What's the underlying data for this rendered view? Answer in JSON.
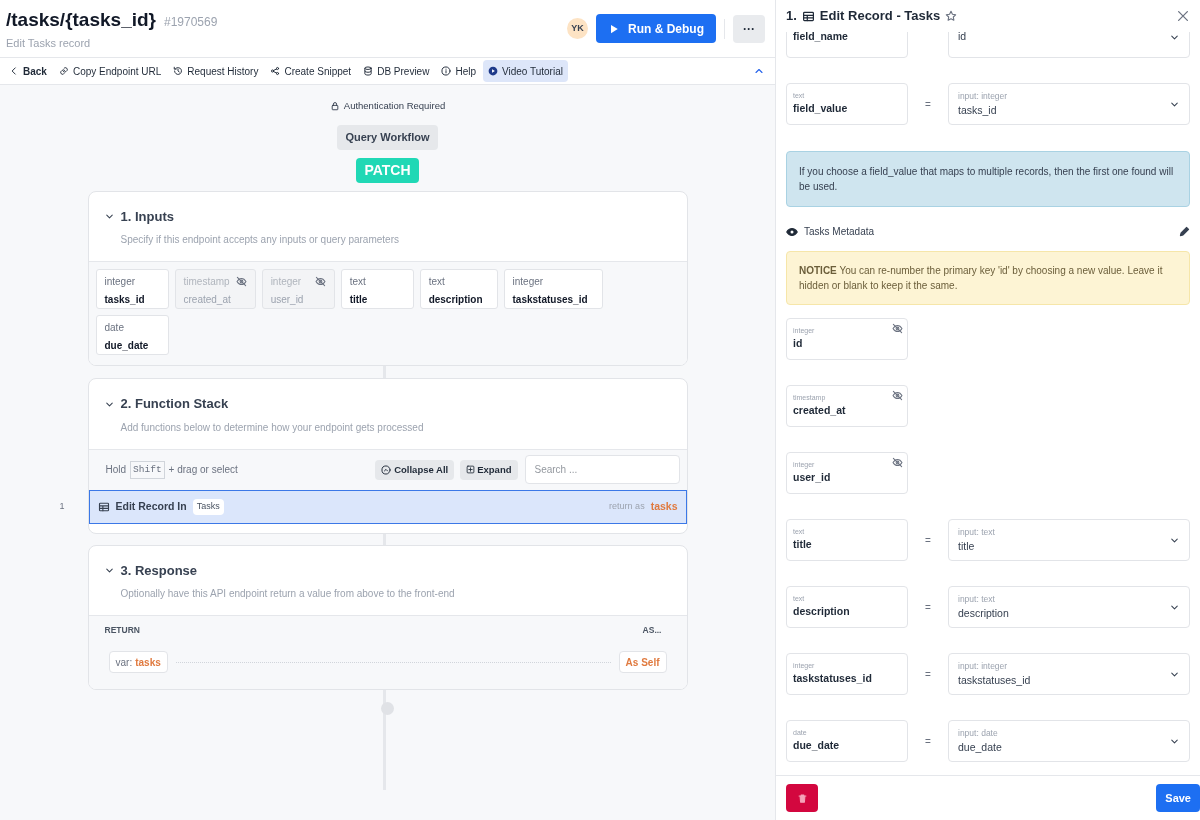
{
  "header": {
    "title": "/tasks/{tasks_id}",
    "id": "#1970569",
    "subtitle": "Edit Tasks record",
    "avatar": "YK",
    "run_button": "Run & Debug",
    "more_button": "···"
  },
  "toolbar": [
    {
      "kind": "back",
      "label": "Back",
      "selected": false
    },
    {
      "kind": "link",
      "label": "Copy Endpoint URL",
      "selected": false
    },
    {
      "kind": "history",
      "label": "Request History",
      "selected": false
    },
    {
      "kind": "share",
      "label": "Create Snippet",
      "selected": false
    },
    {
      "kind": "database",
      "label": "DB Preview",
      "selected": false
    },
    {
      "kind": "info",
      "label": "Help",
      "selected": false
    },
    {
      "kind": "play",
      "label": "Video Tutorial",
      "selected": true
    }
  ],
  "auth_label": "Authentication Required",
  "workflow_label": "Query Workflow",
  "method": "PATCH",
  "inputs": {
    "title": "1. Inputs",
    "description": "Specify if this endpoint accepts any inputs or query parameters",
    "params": [
      {
        "type": "integer",
        "name": "tasks_id",
        "hidden": false
      },
      {
        "type": "timestamp",
        "name": "created_at",
        "hidden": true
      },
      {
        "type": "integer",
        "name": "user_id",
        "hidden": true
      },
      {
        "type": "text",
        "name": "title",
        "hidden": false
      },
      {
        "type": "text",
        "name": "description",
        "hidden": false
      },
      {
        "type": "integer",
        "name": "taskstatuses_id",
        "hidden": false
      },
      {
        "type": "date",
        "name": "due_date",
        "hidden": false
      }
    ]
  },
  "function_stack": {
    "title": "2. Function Stack",
    "description": "Add functions below to determine how your endpoint gets processed",
    "hint_before": "Hold",
    "hint_key": "Shift",
    "hint_after": "+ drag or select",
    "collapse_button": "Collapse All",
    "expand_button": "Expand",
    "search_placeholder": "Search ...",
    "steps": [
      {
        "number": "1",
        "label": "Edit Record In",
        "table": "Tasks",
        "return_label": "return as",
        "return_var": "tasks",
        "selected": true
      }
    ]
  },
  "response": {
    "title": "3. Response",
    "description": "Optionally have this API endpoint return a value from above to the front-end",
    "return_header": "RETURN",
    "as_header": "AS...",
    "var_prefix": "var:",
    "var_name": "tasks",
    "as_value": "As Self"
  },
  "panel": {
    "number": "1.",
    "title": "Edit Record - Tasks",
    "lookup": [
      {
        "name": "field_name",
        "value": "id"
      },
      {
        "type": "text",
        "name": "field_value",
        "operator": "=",
        "input_type": "input: integer",
        "value": "tasks_id"
      }
    ],
    "info": "If you choose a field_value that maps to multiple records, then the first one found will be used.",
    "metadata_label": "Tasks Metadata",
    "notice": "**NOTICE** You can re-number the primary key 'id' by choosing a new value. Leave it hidden or blank to keep it the same.",
    "fields": [
      {
        "type": "integer",
        "name": "id",
        "hidden": true
      },
      {
        "type": "timestamp",
        "name": "created_at",
        "hidden": true
      },
      {
        "type": "integer",
        "name": "user_id",
        "hidden": true
      },
      {
        "type": "text",
        "name": "title",
        "hidden": false,
        "operator": "=",
        "input_type": "input: text",
        "value": "title"
      },
      {
        "type": "text",
        "name": "description",
        "hidden": false,
        "operator": "=",
        "input_type": "input: text",
        "value": "description"
      },
      {
        "type": "integer",
        "name": "taskstatuses_id",
        "hidden": false,
        "operator": "=",
        "input_type": "input: integer",
        "value": "taskstatuses_id"
      },
      {
        "type": "date",
        "name": "due_date",
        "hidden": false,
        "operator": "=",
        "input_type": "input: date",
        "value": "due_date"
      }
    ],
    "save_button": "Save"
  }
}
